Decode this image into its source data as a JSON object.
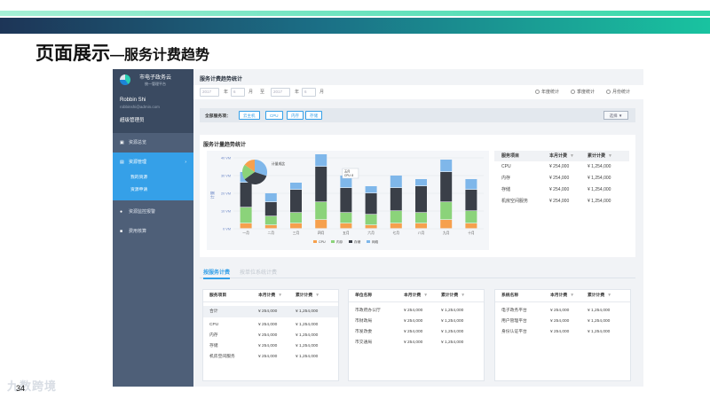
{
  "slide": {
    "title": "页面展示",
    "subtitle": "—服务计费趋势",
    "page_number": "34",
    "watermark": "九数跨境"
  },
  "sidebar": {
    "brand": "市电子政务云",
    "brand_sub": "统一管理平台",
    "user_name": "Robbin Shi",
    "user_email": "robbinshi@admin.com",
    "user_role": "超级管理员",
    "items": [
      {
        "label": "资源总览",
        "icon": "dashboard-icon"
      },
      {
        "label": "资源管理",
        "icon": "folder-icon",
        "expanded": true,
        "children": [
          "我的资源",
          "资源申请"
        ]
      },
      {
        "label": "资源监控报警",
        "icon": "alert-icon"
      },
      {
        "label": "费用核算",
        "icon": "billing-icon"
      }
    ]
  },
  "page": {
    "title": "服务计费趋势统计",
    "date_from_year": "2017",
    "year_unit": "年",
    "date_from_month": "6",
    "month_unit": "月",
    "to_label": "至",
    "date_to_year": "2017",
    "date_to_month": "6",
    "radios": [
      "年度统计",
      "季度统计",
      "月份统计"
    ],
    "all_services_label": "全部服务项：",
    "service_tags": [
      "云主机",
      "CPU",
      "内存",
      "存储"
    ],
    "select_button": "选择"
  },
  "trend_card": {
    "title": "服务计量趋势统计",
    "pie_label": "计量成比",
    "tooltip_title": "五月",
    "tooltip_value": "CPU: 8",
    "summary_headers": [
      "服务项目",
      "本月计费",
      "累计计费"
    ],
    "summary_rows": [
      [
        "CPU",
        "¥ 254,000",
        "¥ 1,254,000"
      ],
      [
        "内存",
        "¥ 254,000",
        "¥ 1,254,000"
      ],
      [
        "存储",
        "¥ 254,000",
        "¥ 1,254,000"
      ],
      [
        "机房空间服务",
        "¥ 254,000",
        "¥ 1,254,000"
      ]
    ]
  },
  "chart_data": {
    "type": "bar",
    "stacked": true,
    "categories": [
      "一月",
      "二月",
      "三月",
      "四月",
      "五月",
      "六月",
      "七月",
      "八月",
      "九月",
      "十月"
    ],
    "series": [
      {
        "name": "CPU",
        "color": "#f6a04d",
        "values": [
          3,
          2,
          3,
          5,
          3,
          2,
          3,
          3,
          5,
          3
        ]
      },
      {
        "name": "内存",
        "color": "#8bd37a",
        "values": [
          9,
          5,
          6,
          10,
          6,
          6,
          7,
          6,
          10,
          7
        ]
      },
      {
        "name": "存储",
        "color": "#3a3f48",
        "values": [
          14,
          8,
          13,
          20,
          14,
          12,
          13,
          15,
          17,
          12
        ]
      },
      {
        "name": "网络",
        "color": "#7fb7ea",
        "values": [
          6,
          5,
          4,
          7,
          7,
          4,
          7,
          4,
          7,
          6
        ]
      }
    ],
    "legend": [
      "CPU",
      "内存",
      "存储",
      "网络"
    ],
    "yticks": [
      "40 VM",
      "30 VM",
      "20 VM",
      "10 VM",
      "0 VM"
    ],
    "ylabel": "计量",
    "ylim": [
      0,
      40
    ],
    "pie": [
      {
        "name": "CPU",
        "value": 30,
        "color": "#7fb7ea"
      },
      {
        "name": "内存",
        "value": 35,
        "color": "#3a3f48"
      },
      {
        "name": "存储",
        "value": 20,
        "color": "#8bd37a"
      },
      {
        "name": "网络",
        "value": 15,
        "color": "#f6a04d"
      }
    ]
  },
  "tabs": [
    "按服务计费",
    "按单位系统计费"
  ],
  "tables": {
    "service": {
      "headers": [
        "服务项目",
        "本月计费",
        "累计计费"
      ],
      "total": [
        "合计",
        "¥ 254,000",
        "¥ 1,254,000"
      ],
      "rows": [
        [
          "CPU",
          "¥ 254,000",
          "¥ 1,254,000"
        ],
        [
          "内存",
          "¥ 254,000",
          "¥ 1,254,000"
        ],
        [
          "存储",
          "¥ 254,000",
          "¥ 1,254,000"
        ],
        [
          "机房空间服务",
          "¥ 254,000",
          "¥ 1,254,000"
        ]
      ]
    },
    "unit": {
      "headers": [
        "单位名称",
        "本月计费",
        "累计计费"
      ],
      "rows": [
        [
          "市政府办公厅",
          "¥ 254,000",
          "¥ 1,254,000"
        ],
        [
          "市财政局",
          "¥ 254,000",
          "¥ 1,254,000"
        ],
        [
          "市发改委",
          "¥ 254,000",
          "¥ 1,254,000"
        ],
        [
          "市交通局",
          "¥ 254,000",
          "¥ 1,254,000"
        ]
      ]
    },
    "system": {
      "headers": [
        "系统名称",
        "本月计费",
        "累计计费"
      ],
      "rows": [
        [
          "电子政务平台",
          "¥ 254,000",
          "¥ 1,254,000"
        ],
        [
          "用户管理平台",
          "¥ 254,000",
          "¥ 1,254,000"
        ],
        [
          "身份认证平台",
          "¥ 254,000",
          "¥ 1,254,000"
        ]
      ]
    }
  }
}
